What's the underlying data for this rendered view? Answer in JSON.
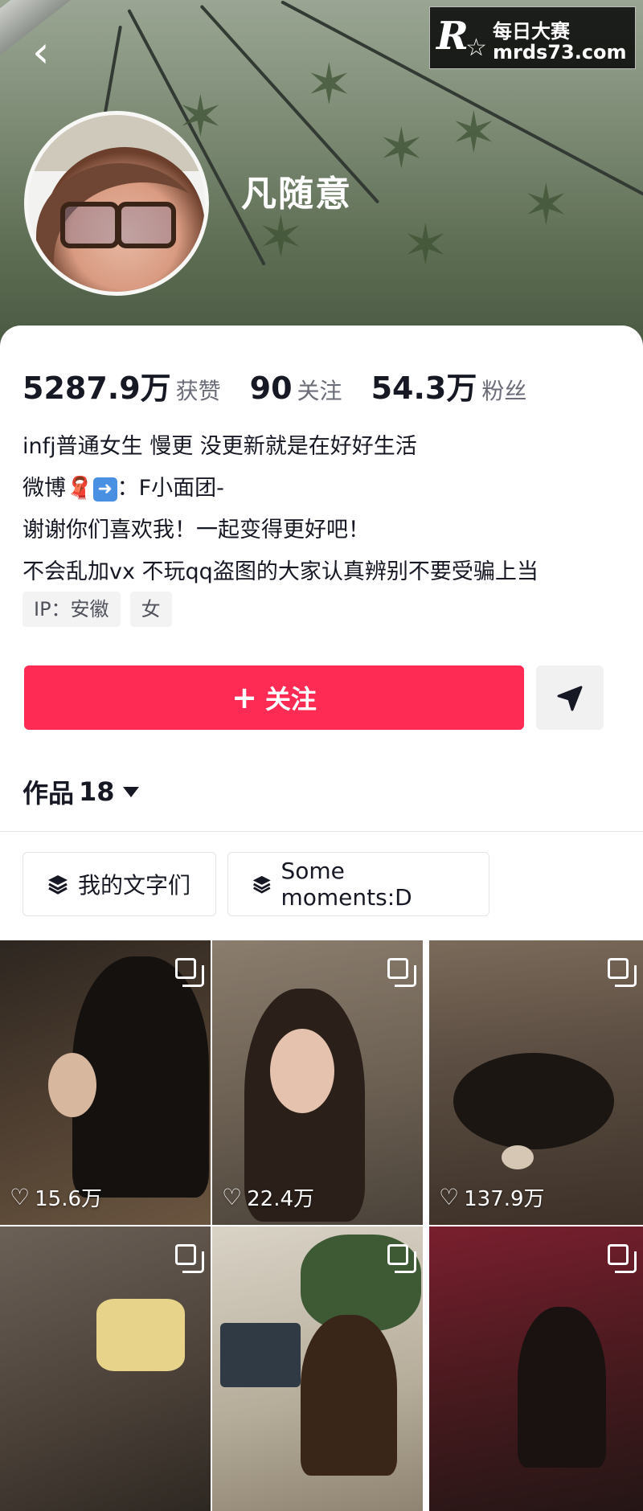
{
  "header": {
    "back_icon": "chevron-left-icon",
    "username": "凡随意"
  },
  "watermark": {
    "logo": "R",
    "brand": "每日大赛",
    "url": "mrds73.com"
  },
  "stats": [
    {
      "num": "5287.9万",
      "label": "获赞"
    },
    {
      "num": "90",
      "label": "关注"
    },
    {
      "num": "54.3万",
      "label": "粉丝"
    }
  ],
  "bio": {
    "line1": "infj普通女生 慢更 没更新就是在好好生活",
    "line2_prefix": "微博",
    "line2_suffix": "：F小面团-",
    "line3": "谢谢你们喜欢我！一起变得更好吧！",
    "line4": "不会乱加vx 不玩qq盗图的大家认真辨别不要受骗上当"
  },
  "tags": [
    "IP：安徽",
    "女"
  ],
  "actions": {
    "follow_label": "关注",
    "share_icon": "paper-plane-icon"
  },
  "works": {
    "title": "作品",
    "count": "18"
  },
  "collections": [
    {
      "label": "我的文字们",
      "icon": "layers-icon"
    },
    {
      "label": "Some moments:D",
      "icon": "layers-icon"
    }
  ],
  "posts": [
    {
      "likes": "15.6万"
    },
    {
      "likes": "22.4万"
    },
    {
      "likes": "137.9万"
    },
    {
      "likes": ""
    },
    {
      "likes": ""
    },
    {
      "likes": ""
    }
  ],
  "colors": {
    "accent": "#fe2c55",
    "text": "#161823",
    "secondary_text": "#6b6d78"
  }
}
